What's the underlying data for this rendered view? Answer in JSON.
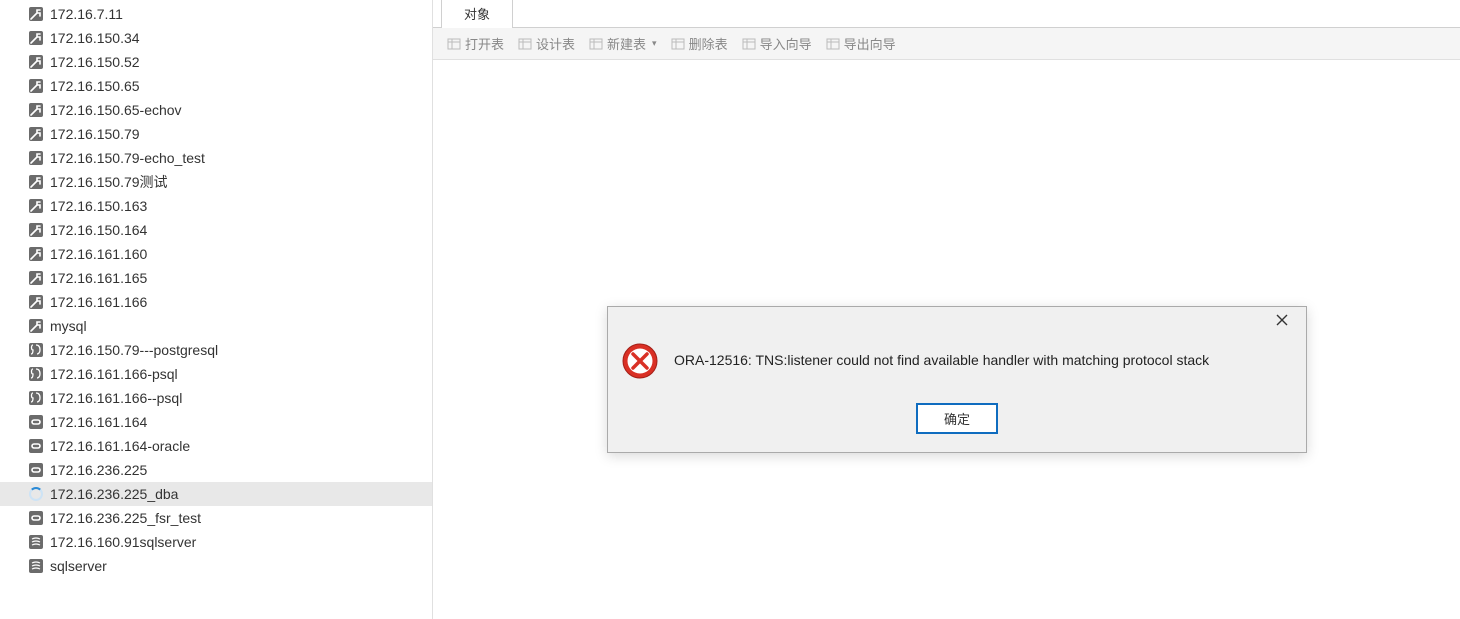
{
  "sidebar": {
    "items": [
      {
        "label": "172.16.7.11",
        "icon": "plug",
        "selected": false
      },
      {
        "label": "172.16.150.34",
        "icon": "plug",
        "selected": false
      },
      {
        "label": "172.16.150.52",
        "icon": "plug",
        "selected": false
      },
      {
        "label": "172.16.150.65",
        "icon": "plug",
        "selected": false
      },
      {
        "label": "172.16.150.65-echov",
        "icon": "plug",
        "selected": false
      },
      {
        "label": "172.16.150.79",
        "icon": "plug",
        "selected": false
      },
      {
        "label": "172.16.150.79-echo_test",
        "icon": "plug",
        "selected": false
      },
      {
        "label": "172.16.150.79测试",
        "icon": "plug",
        "selected": false
      },
      {
        "label": "172.16.150.163",
        "icon": "plug",
        "selected": false
      },
      {
        "label": "172.16.150.164",
        "icon": "plug",
        "selected": false
      },
      {
        "label": "172.16.161.160",
        "icon": "plug",
        "selected": false
      },
      {
        "label": "172.16.161.165",
        "icon": "plug",
        "selected": false
      },
      {
        "label": "172.16.161.166",
        "icon": "plug",
        "selected": false
      },
      {
        "label": "mysql",
        "icon": "plug",
        "selected": false
      },
      {
        "label": "172.16.150.79---postgresql",
        "icon": "postgres",
        "selected": false
      },
      {
        "label": "172.16.161.166-psql",
        "icon": "postgres",
        "selected": false
      },
      {
        "label": "172.16.161.166--psql",
        "icon": "postgres",
        "selected": false
      },
      {
        "label": "172.16.161.164",
        "icon": "oracle",
        "selected": false
      },
      {
        "label": "172.16.161.164-oracle",
        "icon": "oracle",
        "selected": false
      },
      {
        "label": "172.16.236.225",
        "icon": "oracle",
        "selected": false
      },
      {
        "label": "172.16.236.225_dba",
        "icon": "spinner",
        "selected": true
      },
      {
        "label": "172.16.236.225_fsr_test",
        "icon": "oracle",
        "selected": false
      },
      {
        "label": "172.16.160.91sqlserver",
        "icon": "sqlserver",
        "selected": false
      },
      {
        "label": "sqlserver",
        "icon": "sqlserver",
        "selected": false
      }
    ]
  },
  "tabs": [
    {
      "label": "对象"
    }
  ],
  "toolbar": [
    {
      "label": "打开表",
      "icon": "table",
      "dropdown": false
    },
    {
      "label": "设计表",
      "icon": "table",
      "dropdown": false
    },
    {
      "label": "新建表",
      "icon": "table",
      "dropdown": true
    },
    {
      "label": "删除表",
      "icon": "table",
      "dropdown": false
    },
    {
      "label": "导入向导",
      "icon": "table",
      "dropdown": false
    },
    {
      "label": "导出向导",
      "icon": "table",
      "dropdown": false
    }
  ],
  "dialog": {
    "message": "ORA-12516: TNS:listener could not find available handler with matching protocol stack",
    "ok_label": "确定"
  }
}
